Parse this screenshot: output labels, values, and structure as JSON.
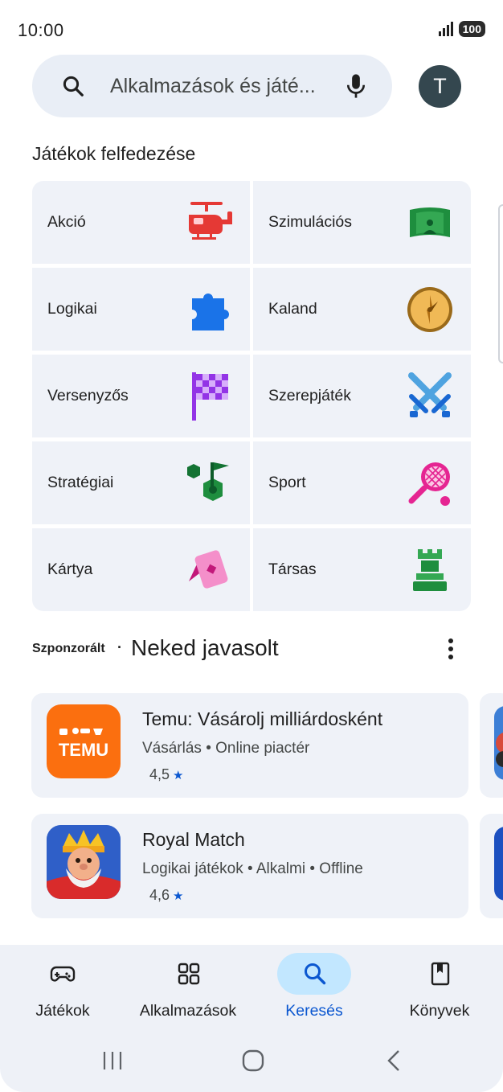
{
  "status": {
    "time": "10:00",
    "battery": "100"
  },
  "search": {
    "placeholder": "Alkalmazások és játé...",
    "avatar_letter": "T"
  },
  "categories": {
    "title": "Játékok felfedezése",
    "items": [
      {
        "label": "Akció",
        "icon": "helicopter-icon"
      },
      {
        "label": "Szimulációs",
        "icon": "simulation-icon"
      },
      {
        "label": "Logikai",
        "icon": "puzzle-icon"
      },
      {
        "label": "Kaland",
        "icon": "compass-icon"
      },
      {
        "label": "Versenyzős",
        "icon": "checkered-flag-icon"
      },
      {
        "label": "Szerepjáték",
        "icon": "crossed-swords-icon"
      },
      {
        "label": "Stratégiai",
        "icon": "strategy-flag-icon"
      },
      {
        "label": "Sport",
        "icon": "tennis-racket-icon"
      },
      {
        "label": "Kártya",
        "icon": "cards-icon"
      },
      {
        "label": "Társas",
        "icon": "chess-rook-icon"
      }
    ]
  },
  "sponsored": {
    "small_label": "Szponzorált",
    "dot": "·",
    "title": "Neked javasolt"
  },
  "apps": [
    {
      "name": "Temu: Vásárolj milliárdosként",
      "meta": "Vásárlás  •  Online piactér",
      "rating": "4,5",
      "icon_text": "TEMU"
    },
    {
      "name": "Royal Match",
      "meta": "Logikai játékok  •  Alkalmi  •  Offline",
      "rating": "4,6"
    }
  ],
  "nav": {
    "items": [
      {
        "label": "Játékok",
        "icon": "gamepad-icon"
      },
      {
        "label": "Alkalmazások",
        "icon": "apps-grid-icon"
      },
      {
        "label": "Keresés",
        "icon": "search-icon"
      },
      {
        "label": "Könyvek",
        "icon": "book-icon"
      }
    ],
    "active_color": "#0b57d0",
    "active_pill": "#c2e7ff"
  }
}
